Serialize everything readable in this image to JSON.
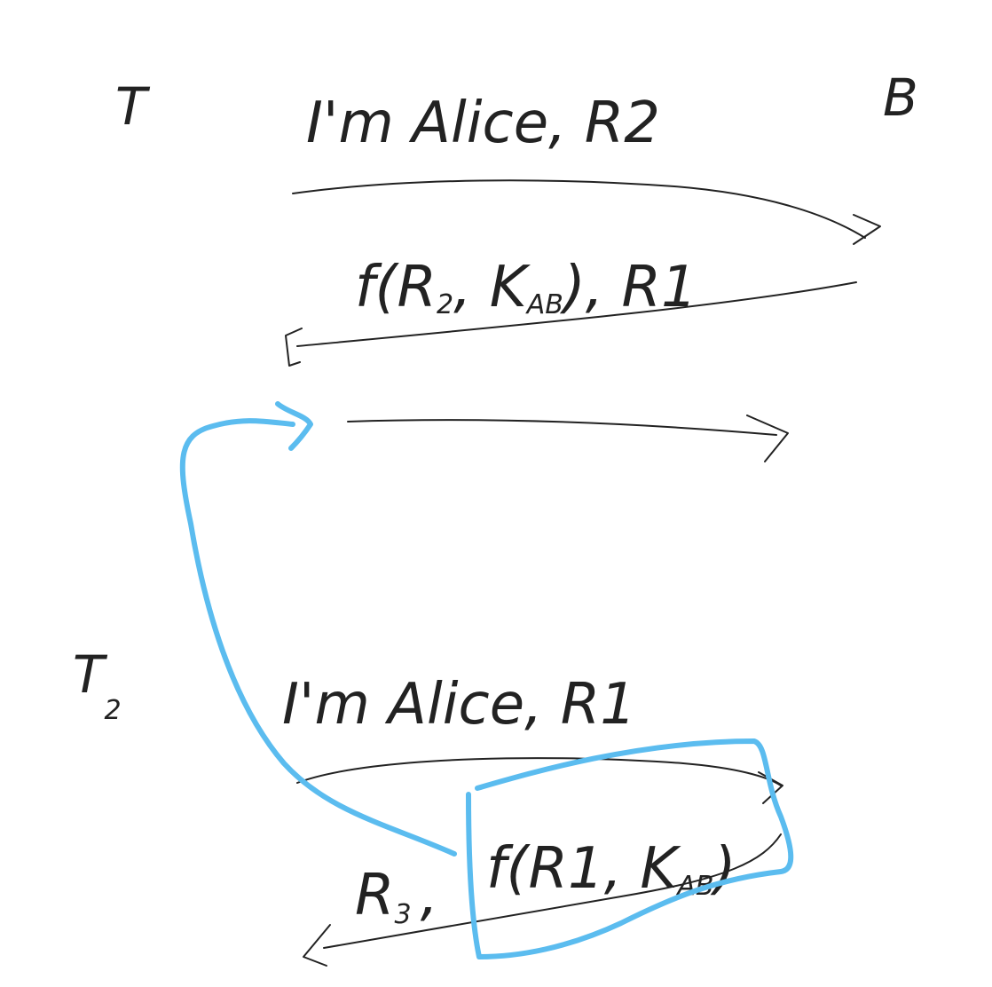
{
  "colors": {
    "ink": "#222222",
    "highlight": "#5bbcef",
    "background": "#ffffff"
  },
  "labels": {
    "trudy": "T",
    "bob": "B",
    "trudy2": "T",
    "trudy2_sub": "2"
  },
  "session1": {
    "msg1": "I'm Alice, R2",
    "msg2_prefix": "f(R",
    "msg2_sub1": "2",
    "msg2_key": ", K",
    "msg2_sub2": "AB",
    "msg2_suffix": "), R1"
  },
  "session2": {
    "msg1": "I'm Alice, R1",
    "msg2_r3": "R",
    "msg2_r3_sub": "3",
    "msg2_comma": ",",
    "msg2_f": "f(R1, K",
    "msg2_f_sub": "AB",
    "msg2_f_close": ")"
  }
}
